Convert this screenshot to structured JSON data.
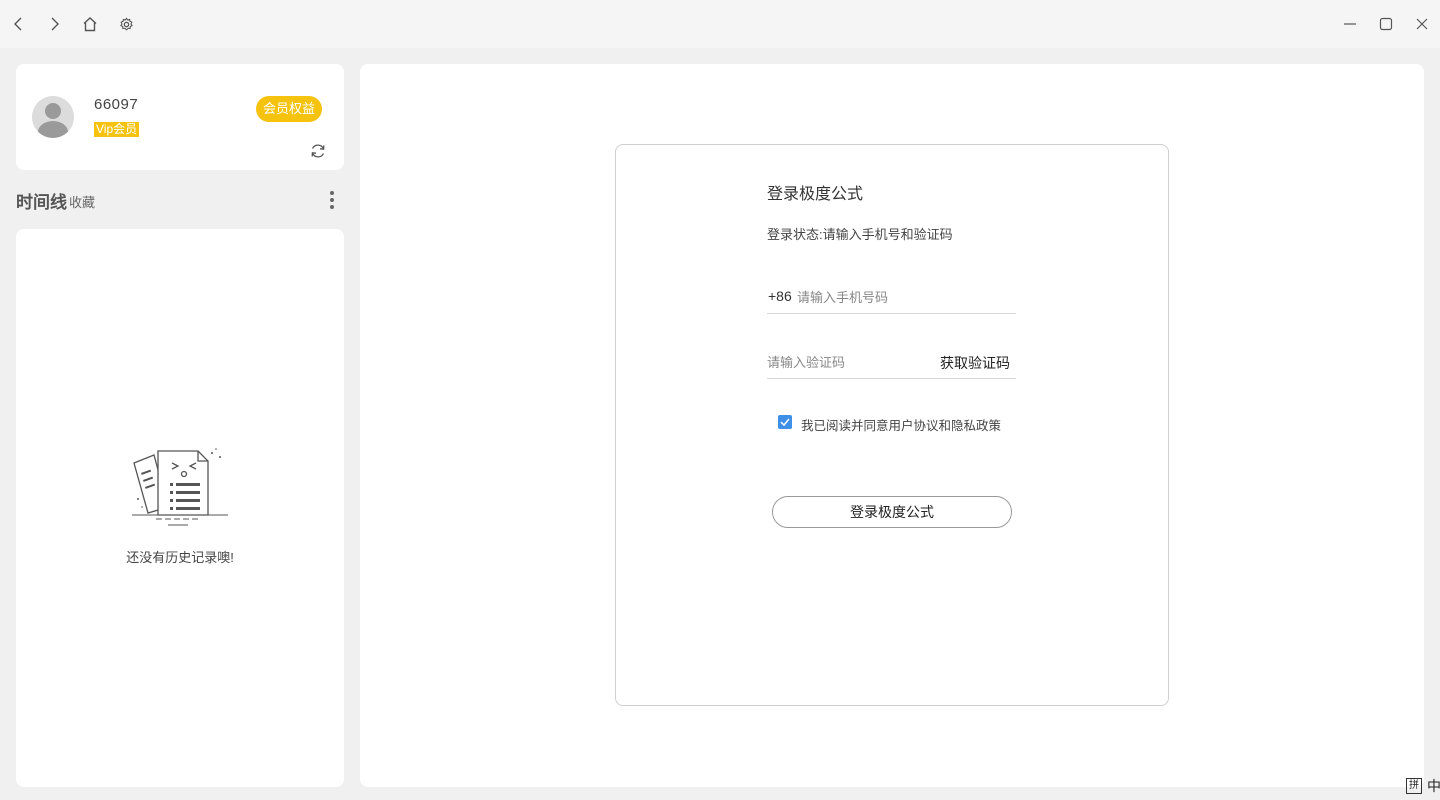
{
  "titlebar": {
    "nav_icons": [
      "back-icon",
      "forward-icon",
      "home-icon",
      "settings-icon"
    ],
    "window_icons": [
      "minimize-icon",
      "maximize-icon",
      "close-icon"
    ]
  },
  "user": {
    "id": "66097",
    "vip_label": "Vip会员",
    "perk_button": "会员权益"
  },
  "timeline": {
    "title": "时间线",
    "favorites": "收藏",
    "empty_text": "还没有历史记录噢!"
  },
  "login": {
    "title": "登录极度公式",
    "status": "登录状态:请输入手机号和验证码",
    "phone_prefix": "+86",
    "phone_placeholder": "请输入手机号码",
    "code_placeholder": "请输入验证码",
    "get_code": "获取验证码",
    "agree_text": "我已阅读并同意用户协议和隐私政策",
    "agree_checked": true,
    "submit": "登录极度公式"
  },
  "ime": {
    "mode": "拼",
    "lang": "中"
  },
  "colors": {
    "accent_yellow": "#f5c20d",
    "checkbox_blue": "#3d8fe8",
    "background": "#f0f0f0"
  }
}
